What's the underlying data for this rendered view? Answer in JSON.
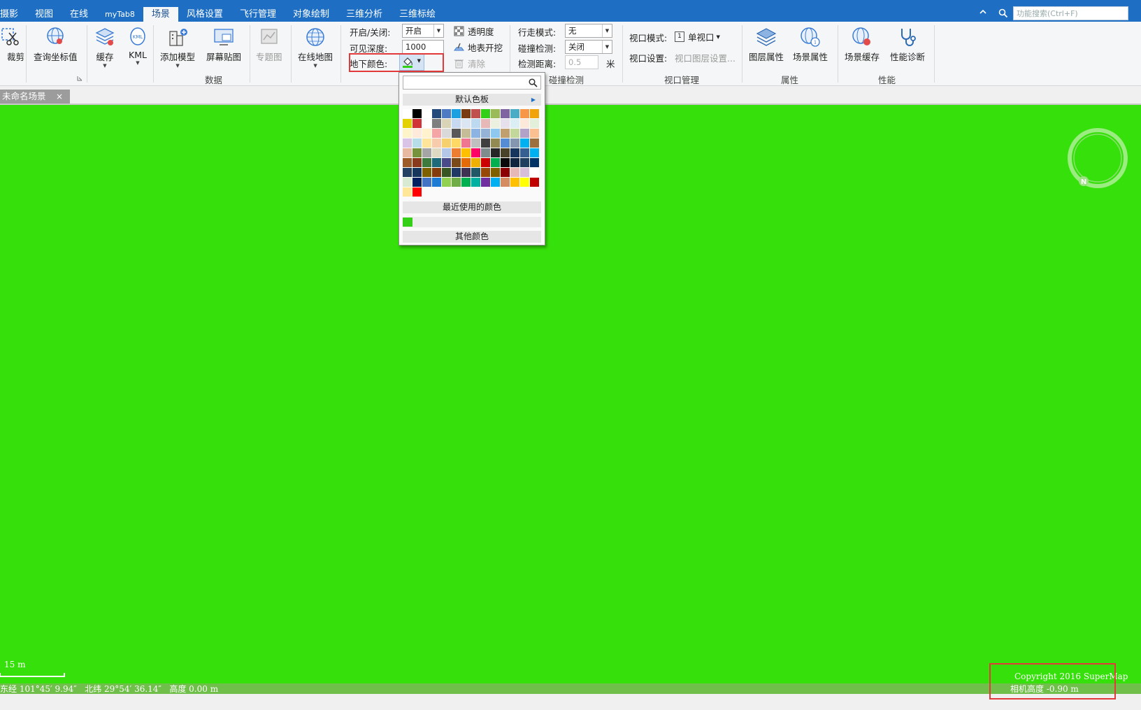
{
  "tabs": [
    "摄影",
    "视图",
    "在线",
    "myTab8",
    "场景",
    "风格设置",
    "飞行管理",
    "对象绘制",
    "三维分析",
    "三维标绘"
  ],
  "active_tab_index": 4,
  "search": {
    "placeholder": "功能搜索(Ctrl+F)"
  },
  "ribbon": {
    "cut_label": "裁剪",
    "query_coords_label": "查询坐标值",
    "cache_label": "缓存",
    "kml_label": "KML",
    "add_model_label": "添加模型",
    "screen_overlay_label": "屏幕贴图",
    "thematic_label": "专题图",
    "online_map_label": "在线地图",
    "data_group_label": "数据",
    "underground": {
      "toggle_label": "开启/关闭:",
      "toggle_value": "开启",
      "depth_label": "可见深度:",
      "depth_value": "1000",
      "color_label": "地下颜色:",
      "transparency_label": "透明度",
      "excavation_label": "地表开挖",
      "clear_label": "清除"
    },
    "walk": {
      "mode_label": "行走模式:",
      "mode_value": "无",
      "collision_label": "碰撞检测:",
      "collision_value": "关闭",
      "distance_label": "检测距离:",
      "distance_value": "0.5",
      "unit": "米",
      "group_label": "碰撞检测"
    },
    "viewport": {
      "mode_label": "视口模式:",
      "mode_value": "单视口",
      "mode_icon_text": "1",
      "settings_label": "视口设置:",
      "settings_value": "视口图层设置...",
      "group_label": "视口管理"
    },
    "layer_props_label": "图层属性",
    "scene_props_label": "场景属性",
    "properties_group_label": "属性",
    "scene_cache_label": "场景缓存",
    "perf_diag_label": "性能诊断",
    "performance_group_label": "性能"
  },
  "document_tab": {
    "title": "未命名场景",
    "close": "×"
  },
  "scene": {
    "ground_color": "#36e00a",
    "scale_text": "15 m",
    "coordinates": "东经 101°45′ 9.94″   北纬 29°54′ 36.14″   高度 0.00 m",
    "copyright": "Copyright 2016 SuperMap",
    "camera_height": "相机高度 -0.90 m",
    "compass_letter": "N"
  },
  "color_popup": {
    "default_palette_label": "默认色板",
    "recent_label": "最近使用的颜色",
    "other_label": "其他颜色",
    "recent_colors": [
      "#33d017"
    ],
    "palette": [
      [
        "#ffffff",
        "#000000",
        "#ffffff",
        "#244a7c",
        "#4d7ac2",
        "#1ba1e2",
        "#7b3b10",
        "#c0504d",
        "#33d017",
        "#9bbb59",
        "#8064a2",
        "#4bacc6",
        "#f79646",
        "#f0a30a"
      ],
      [
        "#e3d200",
        "#d13438",
        "#ffffff",
        "#7f7f7f",
        "#d9d3b8",
        "#c6d9f1",
        "#dce6f2",
        "#bcd9f0",
        "#e6b9b8",
        "#ebf1de",
        "#e5e0ec",
        "#dbeef4",
        "#fde9d9",
        "#e2efda"
      ],
      [
        "#fdf4c9",
        "#fdeada",
        "#fff2cc",
        "#f4a6a6",
        "#d9d9d9",
        "#595959",
        "#c4bd97",
        "#8db3e2",
        "#95b3d7",
        "#8ec8ef",
        "#c0a06e",
        "#c3d69b",
        "#b2a2c7",
        "#fac090"
      ],
      [
        "#d9c3e6",
        "#b7dee8",
        "#ffe599",
        "#f8cbad",
        "#f6d06e",
        "#ffd966",
        "#f07590",
        "#bfbfbf",
        "#3f3f3f",
        "#938953",
        "#548dd4",
        "#8496b0",
        "#00b0f0",
        "#9c6f3d"
      ],
      [
        "#e6b9a0",
        "#76923c",
        "#a5a5a5",
        "#ddd9c3",
        "#b4c7e7",
        "#ed7d31",
        "#ffc000",
        "#ff0066",
        "#7f8c8d",
        "#262626",
        "#494429",
        "#17365d",
        "#366092",
        "#00b0f0"
      ],
      [
        "#9d5b2a",
        "#8a3a1c",
        "#3d7a3d",
        "#1f6a7a",
        "#4a4a8a",
        "#7a4a1a",
        "#e36c09",
        "#f0b000",
        "#cc0000",
        "#00b050",
        "#0a0a0a",
        "#0f243e",
        "#1f3f5f",
        "#003366"
      ],
      [
        "#244062",
        "#16365c",
        "#7f6000",
        "#843c0c",
        "#375623",
        "#203864",
        "#3f3151",
        "#215868",
        "#974806",
        "#7f6000",
        "#8b0000",
        "#e6b8b7",
        "#d8bfd8",
        "#ffffff"
      ],
      [
        "#d9ead3",
        "#002060",
        "#4472c4",
        "#1e7bd4",
        "#92d050",
        "#70ad47",
        "#00b050",
        "#00b0a0",
        "#7030a0",
        "#00b0f0",
        "#d48c60",
        "#ffc000",
        "#ffff00",
        "#c00000"
      ],
      [
        "#ffe699",
        "#ff0000"
      ]
    ]
  }
}
